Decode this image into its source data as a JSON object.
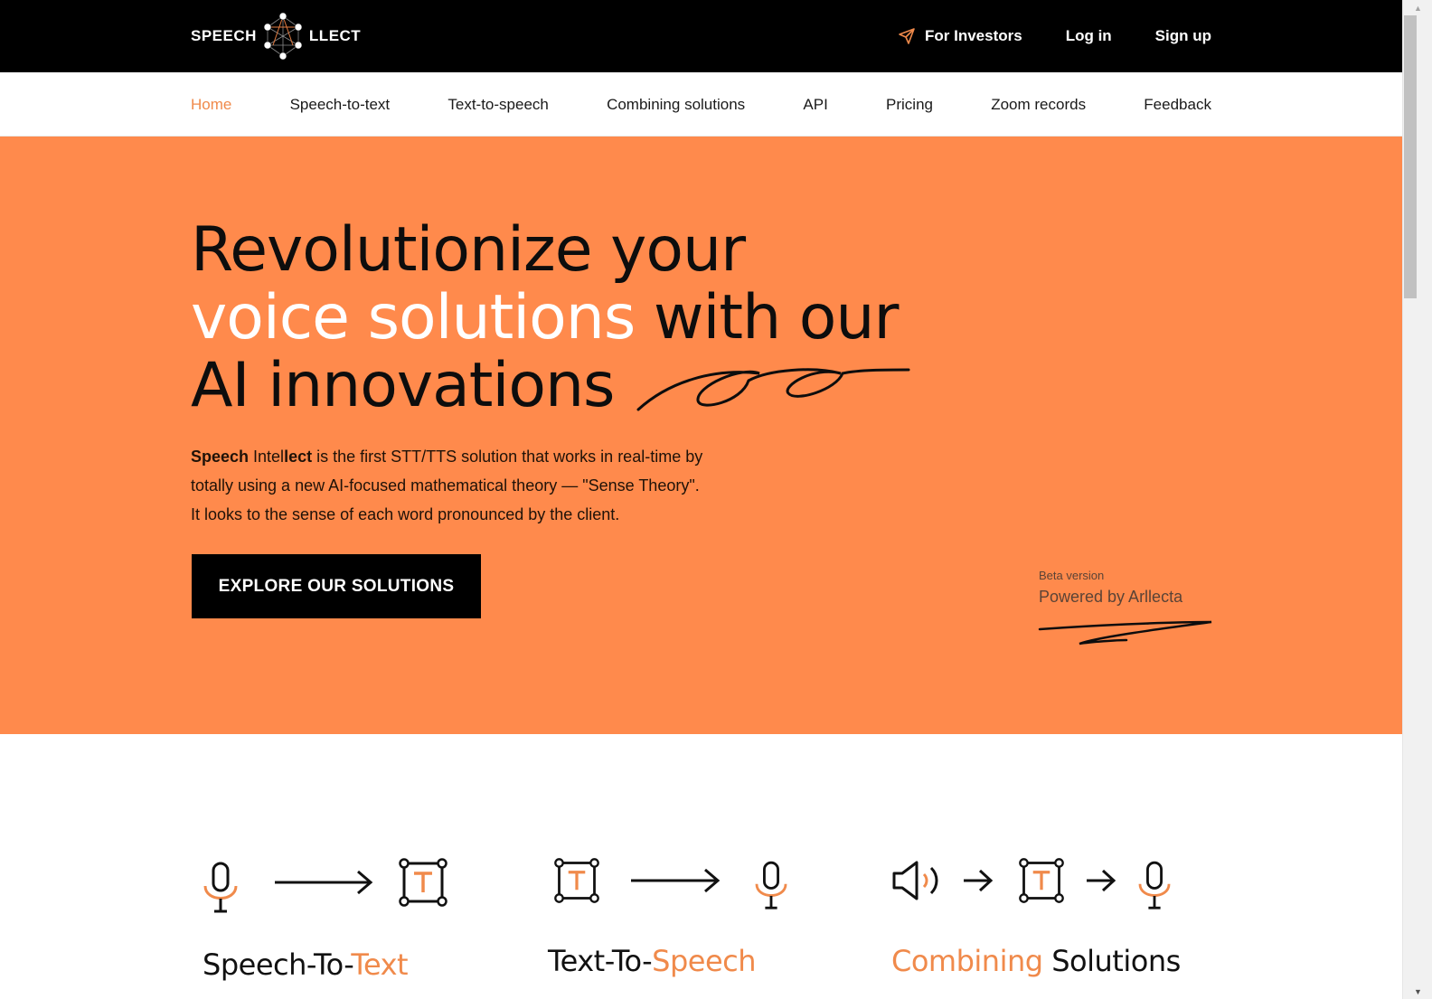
{
  "brand": {
    "name_left": "SPEECH",
    "name_right": "LLECT",
    "accent_color": "#ff8a4c",
    "nav_active_color": "#f08a4b"
  },
  "top_actions": {
    "investors_icon": "paper-plane-icon",
    "investors_label": "For Investors",
    "login_label": "Log in",
    "signup_label": "Sign up"
  },
  "nav": {
    "items": [
      {
        "label": "Home",
        "active": true
      },
      {
        "label": "Speech-to-text",
        "active": false
      },
      {
        "label": "Text-to-speech",
        "active": false
      },
      {
        "label": "Combining solutions",
        "active": false
      },
      {
        "label": "API",
        "active": false
      },
      {
        "label": "Pricing",
        "active": false
      },
      {
        "label": "Zoom records",
        "active": false
      },
      {
        "label": "Feedback",
        "active": false
      }
    ]
  },
  "hero": {
    "headline_line1": "Revolutionize your",
    "headline_line2_highlight": "voice solutions",
    "headline_line2_rest": " with our",
    "headline_line3": "AI innovations",
    "desc_bold1": "Speech",
    "desc_mid": " Intel",
    "desc_bold2": "lect",
    "desc_line1_rest": " is the first STT/TTS solution that works in real-time by",
    "desc_line2": "totally using a new AI-focused mathematical theory — \"Sense Theory\".",
    "desc_line3": "It looks to the sense of each word pronounced by the client.",
    "cta_label": "EXPLORE OUR SOLUTIONS",
    "beta_label": "Beta version",
    "powered_label": "Powered by Arllecta"
  },
  "solutions": [
    {
      "title_part1": "Speech-To-",
      "title_part2": "Text",
      "icons": [
        "microphone-icon",
        "arrow-right-icon",
        "text-frame-icon"
      ]
    },
    {
      "title_part1": "Text-To-",
      "title_part2": "Speech",
      "icons": [
        "text-frame-icon",
        "arrow-right-icon",
        "microphone-icon"
      ]
    },
    {
      "title_part1": "Combining",
      "title_part2": " Solutions",
      "icons": [
        "speaker-icon",
        "arrow-right-icon",
        "text-frame-icon",
        "arrow-right-icon",
        "microphone-icon"
      ]
    }
  ],
  "scrollbar": {
    "up_glyph": "▲",
    "down_glyph": "▼"
  }
}
